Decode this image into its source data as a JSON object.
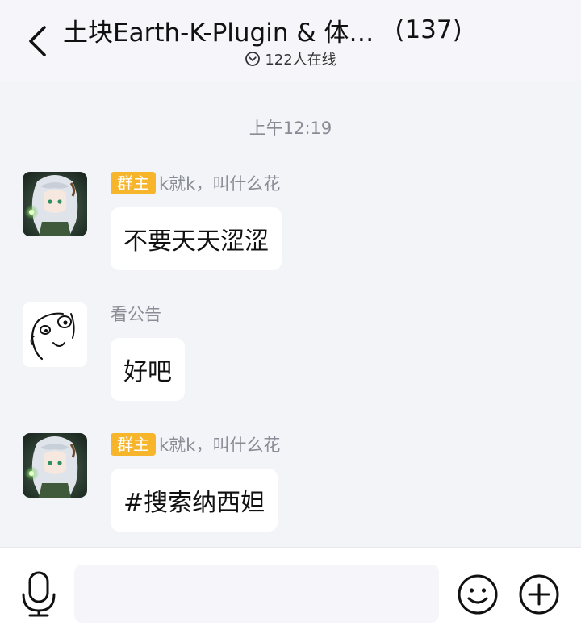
{
  "header": {
    "title": "土块Earth-K-Plugin & 体…",
    "member_count": "(137)",
    "online_text": "122人在线",
    "back_icon": "chevron-left-icon",
    "online_icon": "chevron-down-circle-icon"
  },
  "chat": {
    "timestamp": "上午12:19",
    "messages": [
      {
        "avatar": "anime-character-avatar",
        "role": "群主",
        "sender": "k就k，叫什么花",
        "text": "不要天天涩涩"
      },
      {
        "avatar": "rage-face-avatar",
        "sender": "看公告",
        "text": "好吧"
      },
      {
        "avatar": "anime-character-avatar",
        "role": "群主",
        "sender": "k就k，叫什么花",
        "text": "#搜索纳西妲"
      }
    ]
  },
  "input_bar": {
    "placeholder": "",
    "voice_icon": "microphone-icon",
    "emoji_icon": "smiley-icon",
    "plus_icon": "plus-circle-icon"
  },
  "colors": {
    "badge": "#f7b52c",
    "background": "#f3f4f8",
    "header_bg": "#f5f5fa",
    "bubble": "#ffffff"
  }
}
